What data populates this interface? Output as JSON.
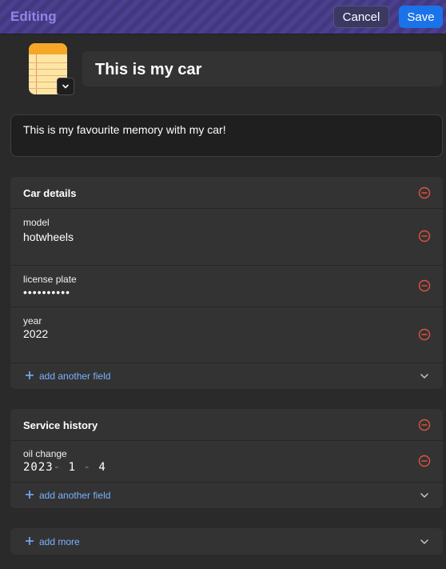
{
  "header": {
    "title": "Editing",
    "cancel_label": "Cancel",
    "save_label": "Save"
  },
  "item": {
    "icon": "notepad-icon",
    "title": "This is my car",
    "notes": "This is my favourite memory with my car!"
  },
  "sections": [
    {
      "title": "Car details",
      "fields": [
        {
          "label": "model",
          "value": "hotwheels"
        },
        {
          "label": "license plate",
          "value": "••••••••••"
        },
        {
          "label": "year",
          "value": "2022"
        }
      ],
      "add_label": "add another field"
    },
    {
      "title": "Service history",
      "fields": [
        {
          "label": "oil change",
          "date": {
            "year": "2023",
            "month": "1",
            "day": "4",
            "separator": "-"
          }
        }
      ],
      "add_label": "add another field"
    }
  ],
  "add_more_label": "add more",
  "colors": {
    "accent": "#1a73e8",
    "remove": "#e0533d",
    "link": "#7ab2ff",
    "header_title": "#8f86e6"
  }
}
